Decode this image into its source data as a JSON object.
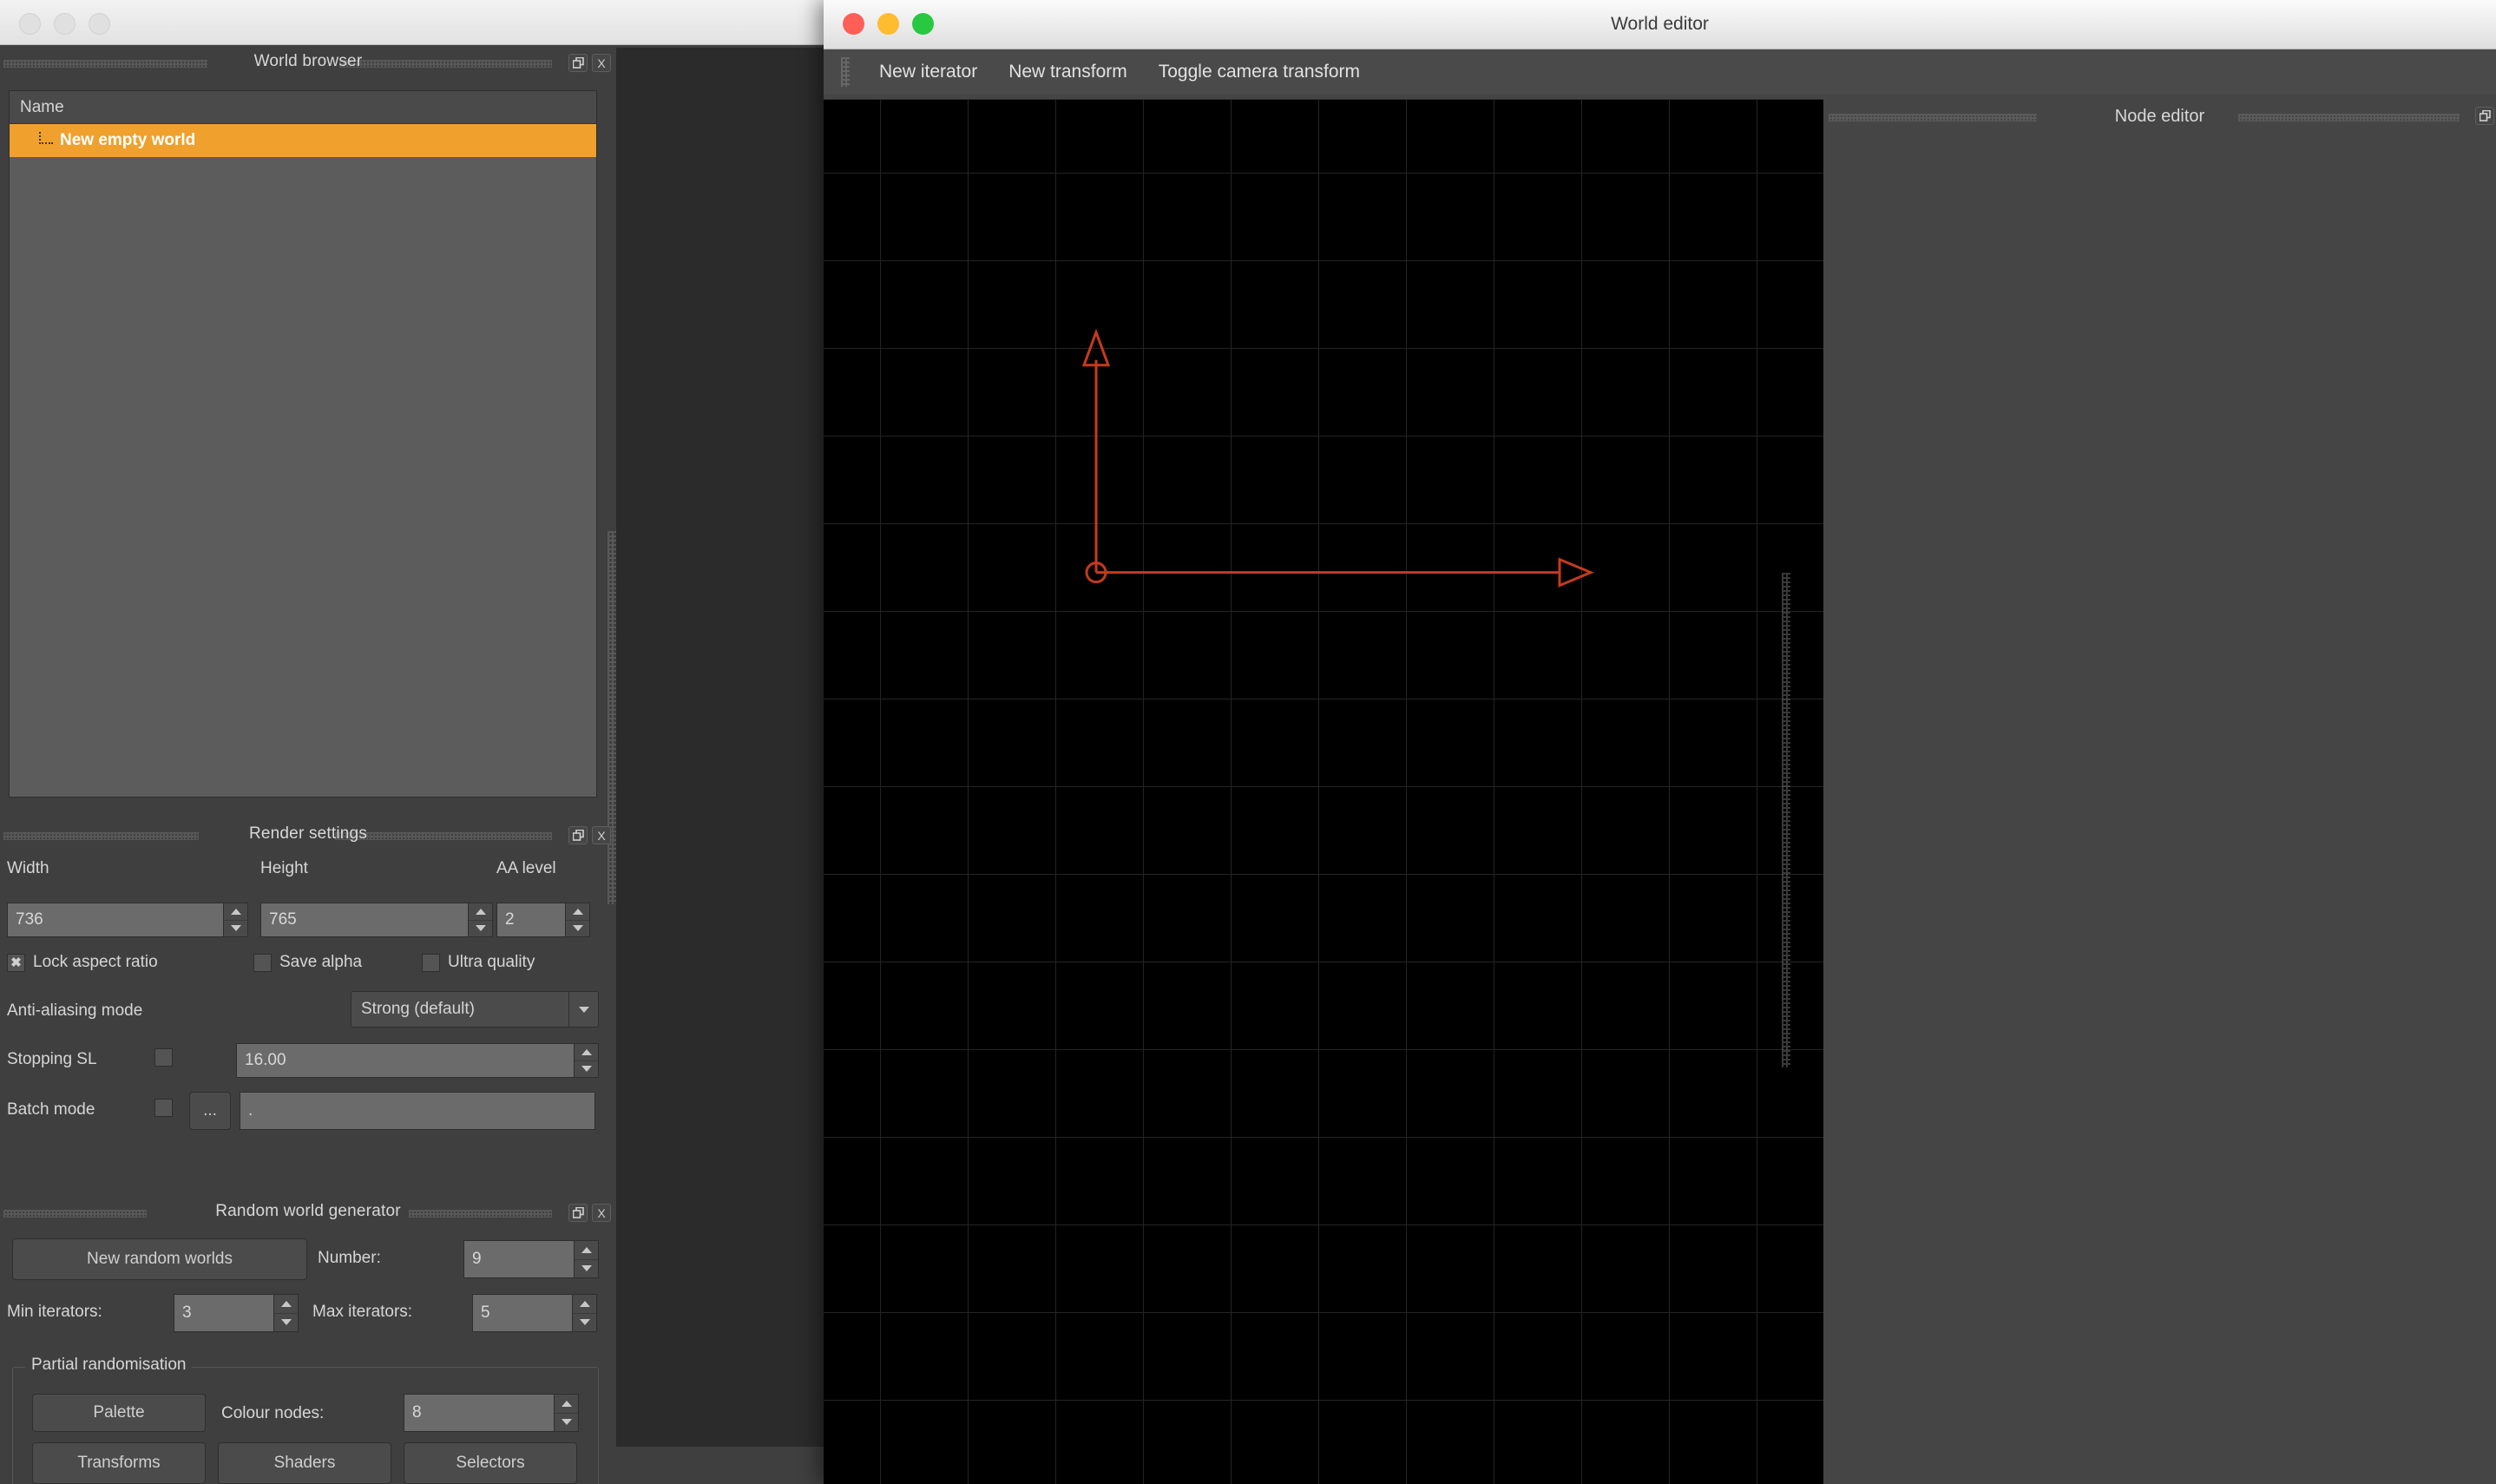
{
  "background_window": {
    "traffic_lights": [
      "close",
      "minimize",
      "zoom"
    ]
  },
  "world_browser": {
    "title": "World browser",
    "column_header": "Name",
    "rows": [
      {
        "label": "New empty world",
        "selected": true
      }
    ],
    "float_button": "float-icon",
    "close_button": "X"
  },
  "render_settings": {
    "title": "Render settings",
    "width_label": "Width",
    "width_value": "736",
    "height_label": "Height",
    "height_value": "765",
    "aa_level_label": "AA level",
    "aa_level_value": "2",
    "lock_aspect_label": "Lock aspect ratio",
    "lock_aspect_checked": "✖",
    "save_alpha_label": "Save alpha",
    "ultra_quality_label": "Ultra quality",
    "aa_mode_label": "Anti-aliasing mode",
    "aa_mode_value": "Strong (default)",
    "stopping_sl_label": "Stopping SL",
    "stopping_sl_value": "16.00",
    "batch_mode_label": "Batch mode",
    "batch_browse_label": "...",
    "batch_path_value": ".",
    "float_button": "float-icon",
    "close_button": "X"
  },
  "random_world_generator": {
    "title": "Random world generator",
    "new_random_worlds_label": "New random worlds",
    "number_label": "Number:",
    "number_value": "9",
    "min_iterators_label": "Min iterators:",
    "min_iterators_value": "3",
    "max_iterators_label": "Max iterators:",
    "max_iterators_value": "5",
    "partial_randomisation_legend": "Partial randomisation",
    "palette_label": "Palette",
    "colour_nodes_label": "Colour nodes:",
    "colour_nodes_value": "8",
    "transforms_label": "Transforms",
    "shaders_label": "Shaders",
    "selectors_label": "Selectors",
    "float_button": "float-icon",
    "close_button": "X"
  },
  "world_editor": {
    "title": "World editor",
    "toolbar": [
      {
        "label": "New iterator"
      },
      {
        "label": "New transform"
      },
      {
        "label": "Toggle camera transform"
      }
    ],
    "canvas": {
      "background_color": "#000000",
      "grid_color": "#3a3a3a",
      "gizmo_color": "#c43a1e",
      "origin_marker": "circle",
      "y_axis_marker": "triangle-up",
      "x_axis_marker": "triangle-right"
    }
  },
  "node_editor": {
    "title": "Node editor",
    "float_button": "float-icon"
  },
  "colors": {
    "selection_orange": "#f0a02c",
    "panel_bg": "#3f3f3f",
    "window_bg": "#454545",
    "toolbar_bg": "#4a4a4a",
    "field_bg": "#6b6b6b",
    "gizmo_red": "#c43a1e"
  }
}
